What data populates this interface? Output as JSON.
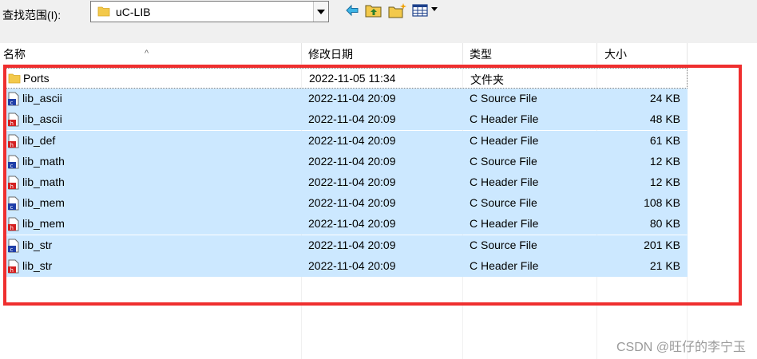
{
  "toolbar": {
    "look_in_label": "查找范围(I):",
    "current_folder": "uC-LIB",
    "icons": [
      "back-arrow-icon",
      "up-folder-icon",
      "new-folder-icon",
      "view-menu-icon"
    ]
  },
  "columns": {
    "name": "名称",
    "date": "修改日期",
    "type": "类型",
    "size": "大小"
  },
  "files": [
    {
      "name": "Ports",
      "date": "2022-11-05 11:34",
      "type": "文件夹",
      "size": "",
      "icon": "folder-icon"
    },
    {
      "name": "lib_ascii",
      "date": "2022-11-04 20:09",
      "type": "C Source File",
      "size": "24 KB",
      "icon": "c-source-file-icon"
    },
    {
      "name": "lib_ascii",
      "date": "2022-11-04 20:09",
      "type": "C Header File",
      "size": "48 KB",
      "icon": "c-header-file-icon"
    },
    {
      "name": "lib_def",
      "date": "2022-11-04 20:09",
      "type": "C Header File",
      "size": "61 KB",
      "icon": "c-header-file-icon"
    },
    {
      "name": "lib_math",
      "date": "2022-11-04 20:09",
      "type": "C Source File",
      "size": "12 KB",
      "icon": "c-source-file-icon"
    },
    {
      "name": "lib_math",
      "date": "2022-11-04 20:09",
      "type": "C Header File",
      "size": "12 KB",
      "icon": "c-header-file-icon"
    },
    {
      "name": "lib_mem",
      "date": "2022-11-04 20:09",
      "type": "C Source File",
      "size": "108 KB",
      "icon": "c-source-file-icon"
    },
    {
      "name": "lib_mem",
      "date": "2022-11-04 20:09",
      "type": "C Header File",
      "size": "80 KB",
      "icon": "c-header-file-icon"
    },
    {
      "name": "lib_str",
      "date": "2022-11-04 20:09",
      "type": "C Source File",
      "size": "201 KB",
      "icon": "c-source-file-icon"
    },
    {
      "name": "lib_str",
      "date": "2022-11-04 20:09",
      "type": "C Header File",
      "size": "21 KB",
      "icon": "c-header-file-icon"
    }
  ],
  "selected_indices": [
    1,
    2,
    3,
    4,
    5,
    6,
    7,
    8,
    9
  ],
  "watermark": "CSDN @旺仔的李宁玉",
  "colors": {
    "selection": "#cce8ff",
    "highlight_box": "#ef2f2f",
    "folder": "#f3c94b"
  }
}
